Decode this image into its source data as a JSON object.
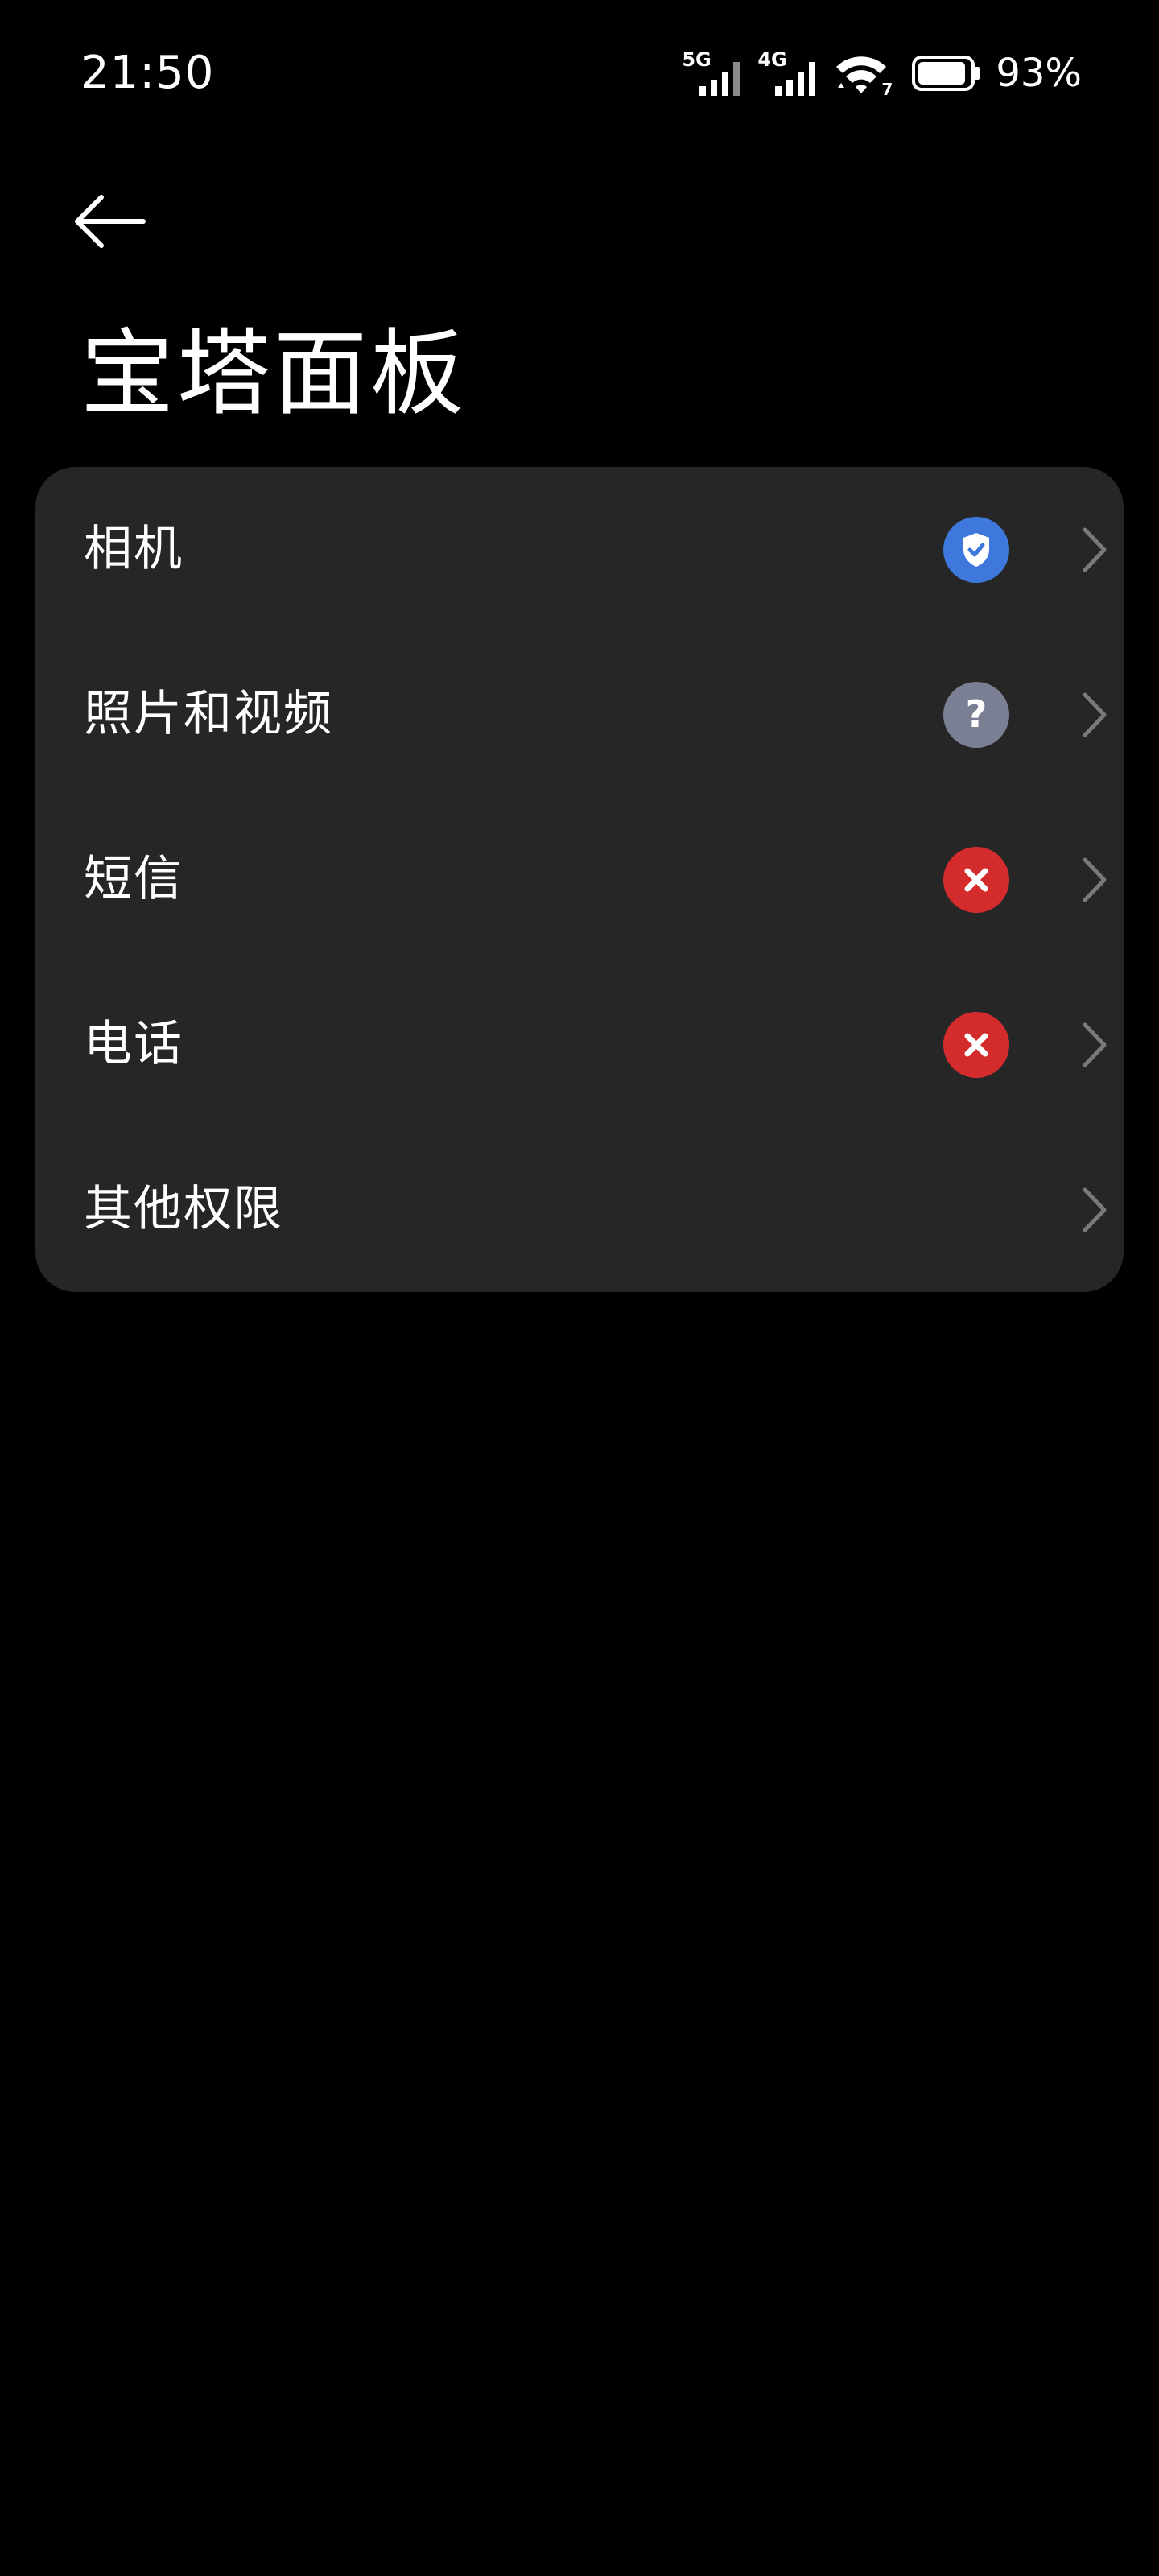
{
  "status_bar": {
    "time": "21:50",
    "signal1_label": "5G",
    "signal2_label": "4G",
    "wifi_label": "7",
    "battery_percent": "93%",
    "battery_level": 0.93
  },
  "header": {
    "back_icon": "back-arrow-icon",
    "title": "宝塔面板"
  },
  "permissions": [
    {
      "label": "相机",
      "status": "allowed",
      "icon": "shield-check-icon",
      "color": "#3f78dc"
    },
    {
      "label": "照片和视频",
      "status": "ask",
      "icon": "question-icon",
      "color": "#7a7f94"
    },
    {
      "label": "短信",
      "status": "denied",
      "icon": "close-icon",
      "color": "#d42c2c"
    },
    {
      "label": "电话",
      "status": "denied",
      "icon": "close-icon",
      "color": "#d42c2c"
    },
    {
      "label": "其他权限",
      "status": "none",
      "icon": "",
      "color": ""
    }
  ],
  "colors": {
    "background": "#000000",
    "card": "#262626",
    "chevron": "#7a7a7a"
  }
}
